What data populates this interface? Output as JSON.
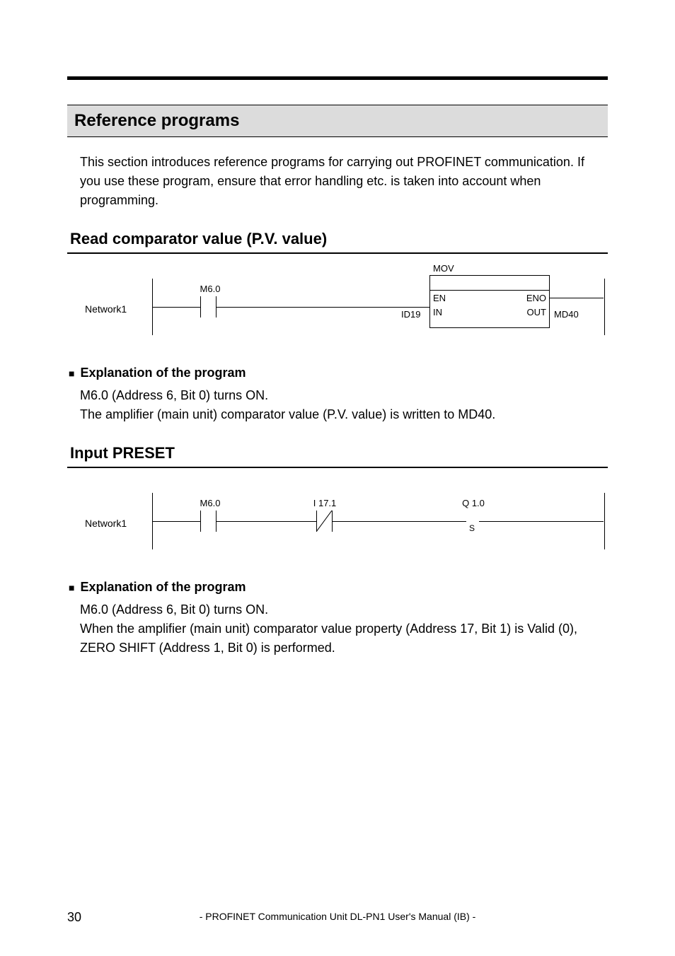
{
  "heading": "Reference programs",
  "intro": "This section introduces reference programs for carrying out PROFINET communication. If you use these program, ensure that error handling etc. is taken into account when programming.",
  "section1": {
    "title": "Read comparator value (P.V. value)",
    "diagram": {
      "network_label": "Network1",
      "contact_label": "M6.0",
      "mov_title": "MOV",
      "en": "EN",
      "eno": "ENO",
      "in": "IN",
      "out": "OUT",
      "in_param": "ID19",
      "out_param": "MD40"
    },
    "explain_head": "Explanation of the program",
    "explain_body": "M6.0 (Address 6, Bit 0) turns ON.\nThe amplifier (main unit) comparator value (P.V. value) is written to MD40."
  },
  "section2": {
    "title": "Input PRESET",
    "diagram": {
      "network_label": "Network1",
      "contact_label": "M6.0",
      "nc_label": "I 17.1",
      "coil_label": "Q 1.0",
      "coil_type": "S"
    },
    "explain_head": "Explanation of the program",
    "explain_body": "M6.0 (Address 6, Bit 0) turns ON.\nWhen the amplifier (main unit) comparator value property (Address 17, Bit 1) is Valid (0), ZERO SHIFT (Address 1, Bit 0) is performed."
  },
  "footer": "- PROFINET Communication Unit DL-PN1 User's Manual (IB) -",
  "page": "30"
}
